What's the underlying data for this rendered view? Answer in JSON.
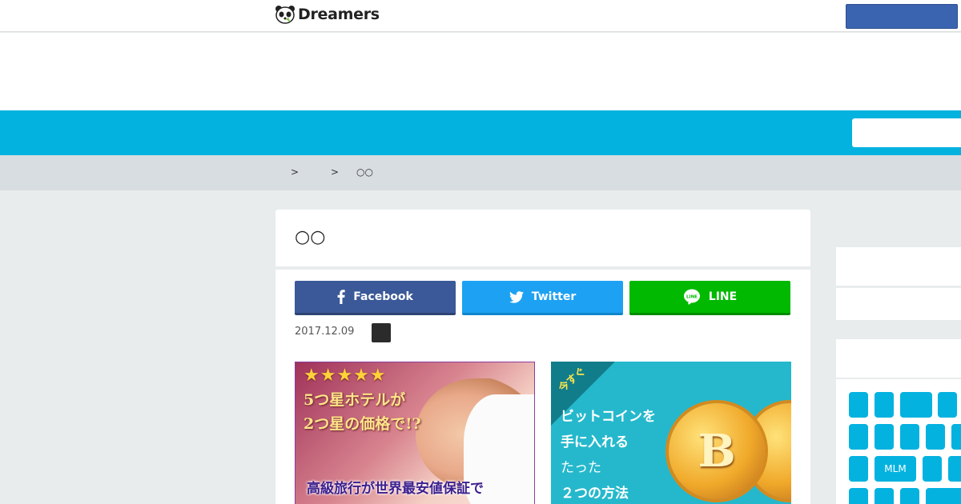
{
  "header": {
    "logo_text": "Dreamers",
    "top_button_label": ""
  },
  "breadcrumb": {
    "items": [
      "",
      "",
      "○○"
    ],
    "separator": ">"
  },
  "article": {
    "title": "○○",
    "date": "2017.12.09"
  },
  "share": {
    "facebook": "Facebook",
    "twitter": "Twitter",
    "line": "LINE"
  },
  "ads": {
    "hotel": {
      "line1": "5つ星ホテルが",
      "line2": "2つ星の価格で!?",
      "line3": "高級旅行が世界最安値保証で"
    },
    "bitcoin": {
      "badge": "今すぐ",
      "line1": "ビットコインを",
      "line2": "手に入れる",
      "line3": "たった",
      "line4": "２つの方法"
    }
  },
  "sidebar": {
    "tags": [
      "",
      "",
      "",
      "",
      "",
      "",
      "",
      "",
      "",
      "",
      "MLM",
      "",
      "",
      "",
      "",
      "",
      ""
    ]
  },
  "colors": {
    "accent": "#04b2e0",
    "facebook": "#3b5998",
    "twitter": "#1da1f2",
    "line": "#00b900"
  }
}
